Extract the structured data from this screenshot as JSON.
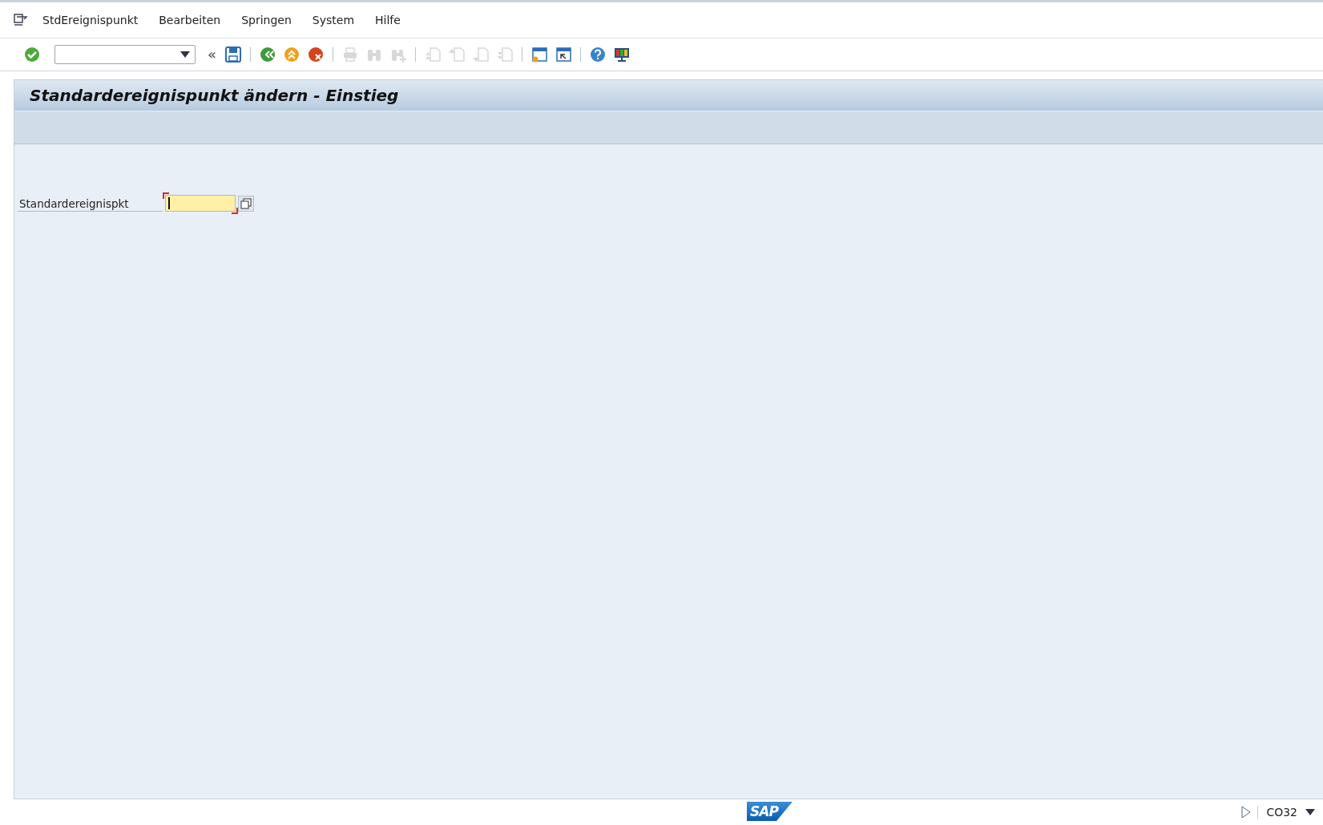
{
  "menu_bar": {
    "items": [
      {
        "label": "StdEreignispunkt"
      },
      {
        "label": "Bearbeiten"
      },
      {
        "label": "Springen"
      },
      {
        "label": "System"
      },
      {
        "label": "Hilfe"
      }
    ]
  },
  "toolbar": {
    "items": [
      {
        "kind": "enter",
        "disabled": false
      },
      {
        "kind": "command_field"
      },
      {
        "kind": "collapse",
        "text": "«"
      },
      {
        "kind": "save",
        "disabled": false
      },
      {
        "kind": "separator"
      },
      {
        "kind": "back",
        "disabled": false
      },
      {
        "kind": "exit",
        "disabled": false
      },
      {
        "kind": "cancel",
        "disabled": false
      },
      {
        "kind": "separator"
      },
      {
        "kind": "print",
        "disabled": true
      },
      {
        "kind": "find",
        "disabled": true
      },
      {
        "kind": "find_next",
        "disabled": true
      },
      {
        "kind": "separator"
      },
      {
        "kind": "first_page",
        "disabled": true
      },
      {
        "kind": "prev_page",
        "disabled": true
      },
      {
        "kind": "next_page",
        "disabled": true
      },
      {
        "kind": "last_page",
        "disabled": true
      },
      {
        "kind": "separator"
      },
      {
        "kind": "new_session",
        "disabled": false
      },
      {
        "kind": "shortcut",
        "disabled": false
      },
      {
        "kind": "separator"
      },
      {
        "kind": "help",
        "disabled": false
      },
      {
        "kind": "layout",
        "disabled": false
      }
    ]
  },
  "screen": {
    "title": "Standardereignispunkt ändern - Einstieg",
    "fields": [
      {
        "label": "Standardereignispkt",
        "required": true,
        "focused": true
      }
    ]
  },
  "status_bar": {
    "logo": "SAP",
    "transaction": "CO32"
  }
}
